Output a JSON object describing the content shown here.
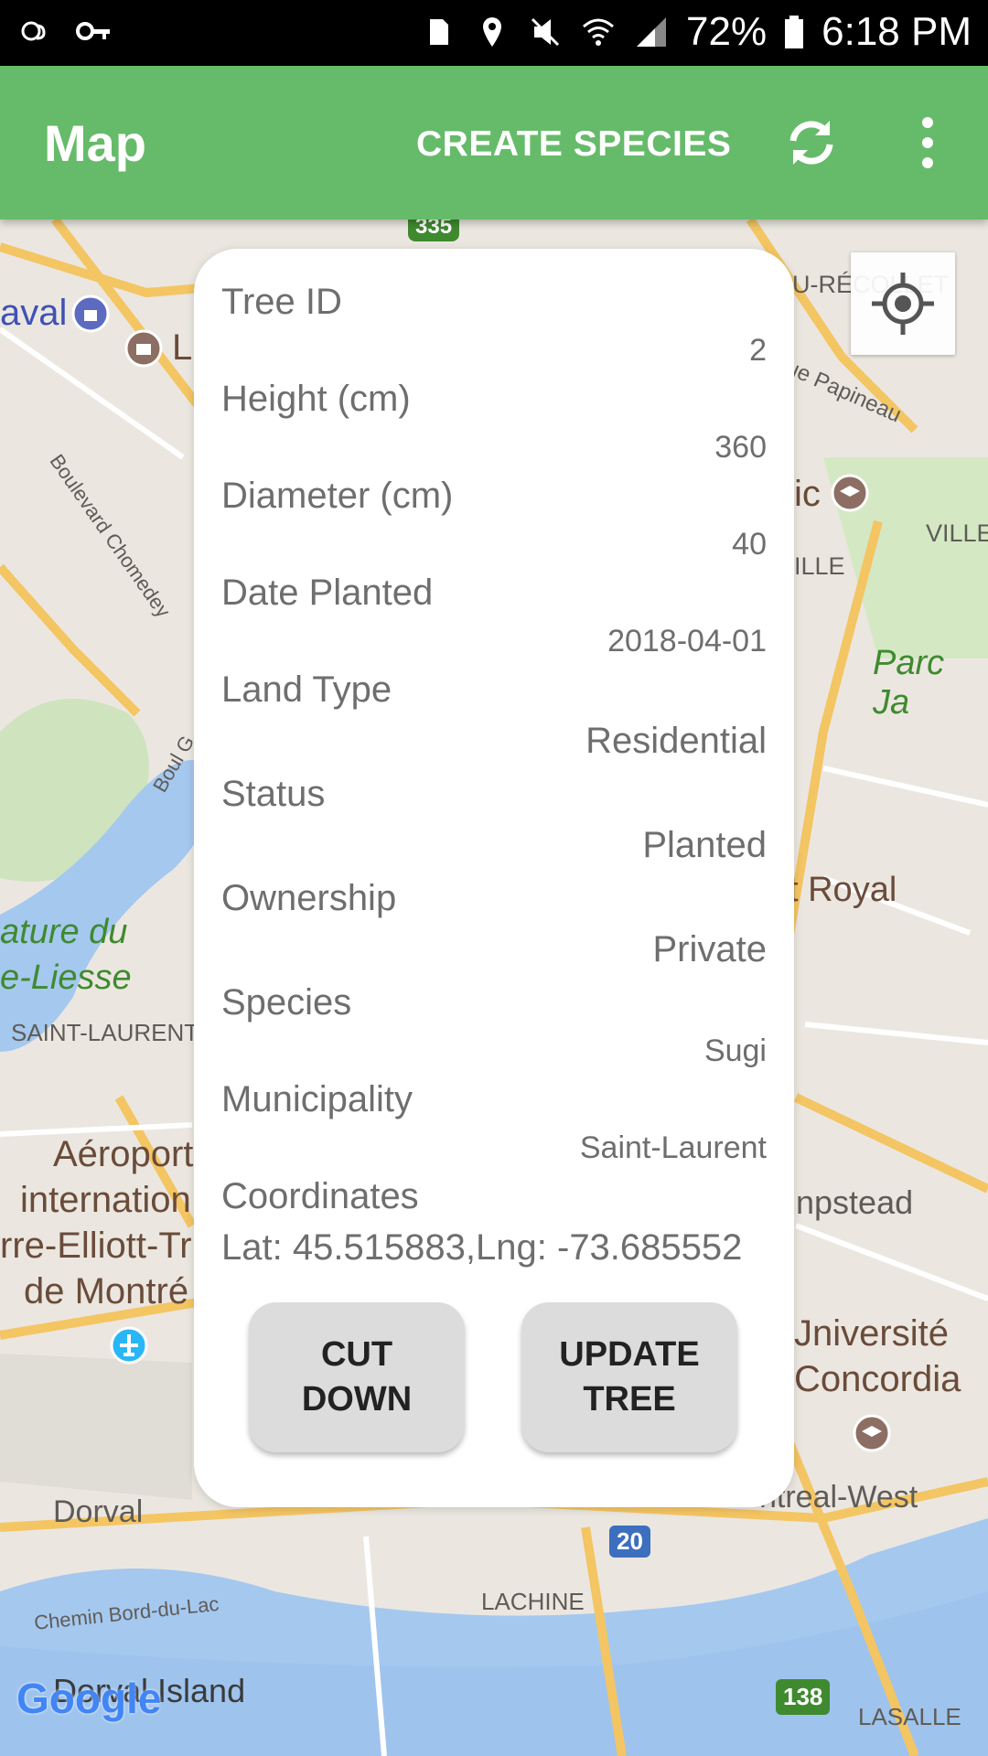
{
  "status_bar": {
    "battery": "72%",
    "time": "6:18 PM",
    "icons": [
      "weather-icon",
      "key-icon",
      "sim-icon",
      "location-icon",
      "mute-icon",
      "wifi-icon",
      "signal-icon",
      "battery-icon"
    ]
  },
  "appbar": {
    "title": "Map",
    "create_species": "CREATE SPECIES",
    "sync_icon": "sync-icon",
    "more_icon": "more-vert-icon",
    "color": "#66bb6a"
  },
  "map": {
    "labels": {
      "laval": "aval",
      "l": "L",
      "recollet": "U-RÉCOLLET",
      "papineau": "ue Papineau",
      "chomedey": "Boulevard Chomedey",
      "ic": "ic",
      "ville_r": "VILLE",
      "ille": "ILLE",
      "parc": "Parc Ja",
      "boulg": "Boul G",
      "royal": "t Royal",
      "nature": "ature du",
      "liesse": "e-Liesse",
      "saint_laurent": "SAINT-LAURENT",
      "aeroport": "Aéroport",
      "internation": "internation",
      "elliott": "rre-Elliott-Tr",
      "montre": "de Montré",
      "hampstead": "npstead",
      "universite": "Jniversité",
      "concordia": "Concordia",
      "dorval": "Dorval",
      "montreal_west": "ntreal-West",
      "route20": "20",
      "bord_du_lac": "Chemin Bord-du-Lac",
      "lachine": "LACHINE",
      "dorval_island": "Dorval Island",
      "route138": "138",
      "lasalle": "LASALLE",
      "route335": "335",
      "google": "Google"
    },
    "locate_icon": "my-location-icon"
  },
  "tree": {
    "fields": [
      {
        "label": "Tree ID",
        "value": "2"
      },
      {
        "label": "Height (cm)",
        "value": "360"
      },
      {
        "label": "Diameter (cm)",
        "value": "40"
      },
      {
        "label": "Date Planted",
        "value": "2018-04-01"
      },
      {
        "label": "Land Type",
        "value": "Residential"
      },
      {
        "label": "Status",
        "value": "Planted"
      },
      {
        "label": "Ownership",
        "value": "Private"
      },
      {
        "label": "Species",
        "value": "Sugi"
      },
      {
        "label": "Municipality",
        "value": "Saint-Laurent"
      }
    ],
    "coordinates_label": "Coordinates",
    "coordinates_value": "Lat: 45.515883,Lng: -73.685552",
    "cut_down": "CUT\nDOWN",
    "update_tree": "UPDATE\nTREE"
  }
}
